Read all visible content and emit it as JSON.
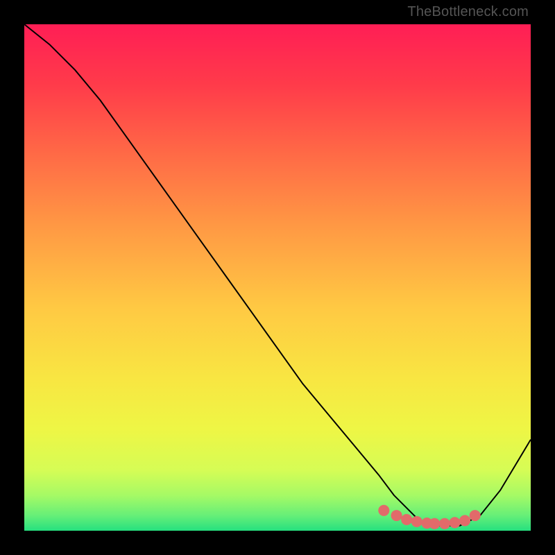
{
  "watermark": "TheBottleneck.com",
  "chart_data": {
    "type": "line",
    "title": "",
    "xlabel": "",
    "ylabel": "",
    "xlim": [
      0,
      100
    ],
    "ylim": [
      0,
      100
    ],
    "series": [
      {
        "name": "curve",
        "x": [
          0,
          5,
          10,
          15,
          20,
          25,
          30,
          35,
          40,
          45,
          50,
          55,
          60,
          65,
          70,
          73,
          76,
          78,
          80,
          83,
          86,
          90,
          94,
          97,
          100
        ],
        "y": [
          100,
          96,
          91,
          85,
          78,
          71,
          64,
          57,
          50,
          43,
          36,
          29,
          23,
          17,
          11,
          7,
          4,
          2,
          1,
          1,
          1,
          3,
          8,
          13,
          18
        ]
      },
      {
        "name": "dots",
        "x": [
          71,
          73.5,
          75.5,
          77.5,
          79.5,
          81,
          83,
          85,
          87,
          89
        ],
        "y": [
          4,
          3,
          2.2,
          1.8,
          1.5,
          1.4,
          1.4,
          1.6,
          2.0,
          3.0
        ]
      }
    ],
    "gradient_stops": [
      {
        "pos": 0.0,
        "color": "#ff1e55"
      },
      {
        "pos": 0.12,
        "color": "#ff3b4a"
      },
      {
        "pos": 0.26,
        "color": "#ff6b46"
      },
      {
        "pos": 0.4,
        "color": "#ff9944"
      },
      {
        "pos": 0.56,
        "color": "#ffc943"
      },
      {
        "pos": 0.7,
        "color": "#f8e642"
      },
      {
        "pos": 0.8,
        "color": "#eef645"
      },
      {
        "pos": 0.88,
        "color": "#d6fc55"
      },
      {
        "pos": 0.93,
        "color": "#a6fa65"
      },
      {
        "pos": 0.97,
        "color": "#66ef78"
      },
      {
        "pos": 1.0,
        "color": "#26e07f"
      }
    ],
    "curve_color": "#000000",
    "dot_color": "#e26a6a",
    "dot_radius": 8
  }
}
